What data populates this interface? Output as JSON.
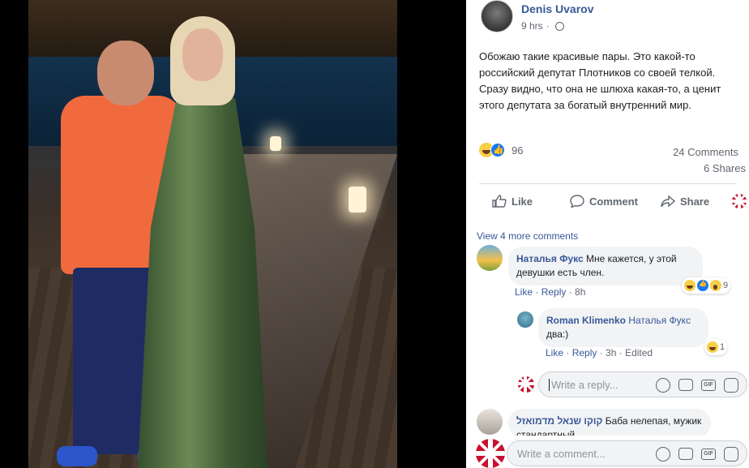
{
  "post": {
    "author": "Denis Uvarov",
    "time": "9 hrs",
    "text": "Обожаю такие красивые пары. Это какой-то российский депутат Плотников со своей телкой. Сразу видно, что она не шлюха какая-то, а ценит этого депутата за богатый внутренний мир.",
    "reaction_count": "96",
    "comments_count": "24 Comments",
    "shares_count": "6 Shares"
  },
  "actions": {
    "like": "Like",
    "comment": "Comment",
    "share": "Share"
  },
  "comments": {
    "view_more": "View 4 more comments",
    "items": [
      {
        "name": "Наталья Фукс",
        "text": "Мне кажется, у этой девушки есть член.",
        "like": "Like",
        "reply": "Reply",
        "time": "8h",
        "reaction_count": "9"
      },
      {
        "name": "Roman Klimenko",
        "mention": "Наталья Фукс",
        "text": "два:)",
        "like": "Like",
        "reply": "Reply",
        "time": "3h",
        "edited": "Edited",
        "reaction_count": "1"
      },
      {
        "name": "קוקו שנאל מדמואזל",
        "text": "Баба нелепая, мужик стандартный"
      }
    ],
    "reply_placeholder": "Write a reply...",
    "comment_placeholder": "Write a comment..."
  },
  "colors": {
    "link": "#385898",
    "muted": "#606770",
    "like_blue": "#1877f2"
  }
}
